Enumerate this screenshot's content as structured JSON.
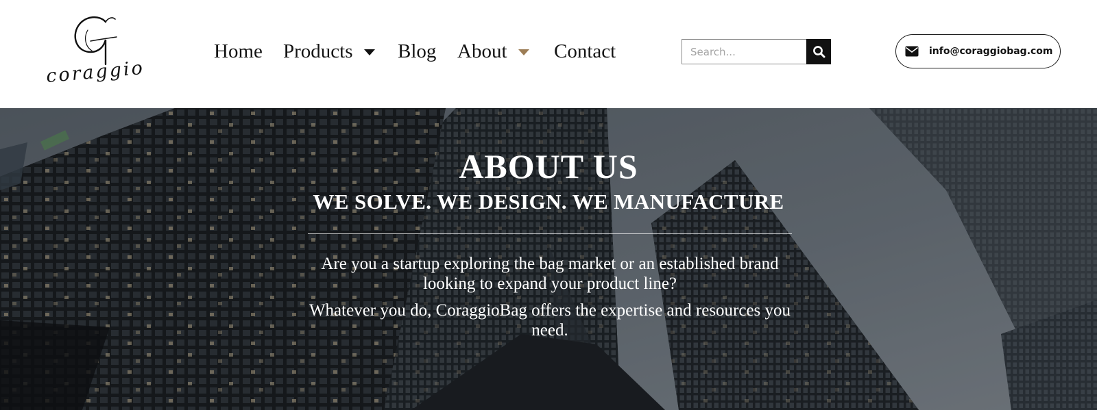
{
  "logo": {
    "monogram": "G",
    "word": "coraggio"
  },
  "nav": {
    "items": [
      {
        "label": "Home",
        "has_dropdown": false
      },
      {
        "label": "Products",
        "has_dropdown": true,
        "caret_color": "#111111"
      },
      {
        "label": "Blog",
        "has_dropdown": false
      },
      {
        "label": "About",
        "has_dropdown": true,
        "caret_color": "#9c7d55"
      },
      {
        "label": "Contact",
        "has_dropdown": false
      }
    ]
  },
  "search": {
    "placeholder": "Search...",
    "icon": "search-icon"
  },
  "contact": {
    "icon": "envelope-icon",
    "email": "info@coraggiobag.com"
  },
  "hero": {
    "background": "skyscrapers-photo",
    "title": "ABOUT US",
    "subtitle": "WE SOLVE. WE DESIGN. WE MANUFACTURE",
    "paragraph_1": "Are you a startup exploring the bag market or an established brand looking to expand your product line?",
    "paragraph_2": "Whatever you do, CoraggioBag offers the expertise and resources you need."
  },
  "colors": {
    "header_bg": "#ffffff",
    "text_dark": "#141414",
    "accent_gold": "#9c7d55",
    "hero_text": "#ffffff"
  }
}
